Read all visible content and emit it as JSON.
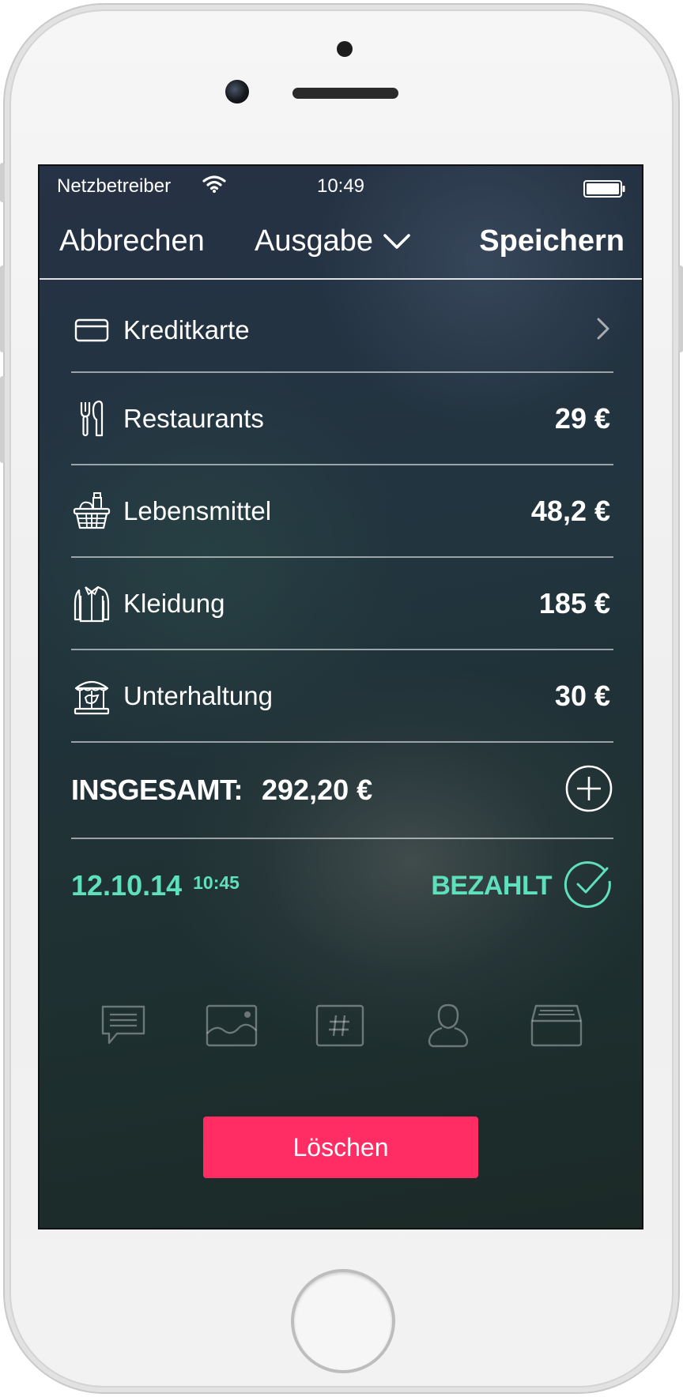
{
  "status_bar": {
    "carrier": "Netzbetreiber",
    "time": "10:49"
  },
  "nav": {
    "cancel_label": "Abbrechen",
    "title": "Ausgabe",
    "save_label": "Speichern"
  },
  "payment": {
    "label": "Kreditkarte",
    "icon": "credit-card-icon"
  },
  "categories": [
    {
      "label": "Restaurants",
      "amount": "29 €",
      "icon": "fork-knife-icon"
    },
    {
      "label": "Lebensmittel",
      "amount": "48,2 €",
      "icon": "grocery-basket-icon"
    },
    {
      "label": "Kleidung",
      "amount": "185 €",
      "icon": "shirt-icon"
    },
    {
      "label": "Unterhaltung",
      "amount": "30 €",
      "icon": "carousel-icon"
    }
  ],
  "total": {
    "label": "INSGESAMT:",
    "value": "292,20 €"
  },
  "status": {
    "date": "12.10.14",
    "time": "10:45",
    "paid_label": "BEZAHLT"
  },
  "toolbar": {
    "icons": [
      "comment-icon",
      "image-icon",
      "hashtag-icon",
      "person-icon",
      "archive-icon"
    ]
  },
  "delete_label": "Löschen",
  "colors": {
    "accent_green": "#5fe0bc",
    "delete_red": "#ff2d63"
  }
}
